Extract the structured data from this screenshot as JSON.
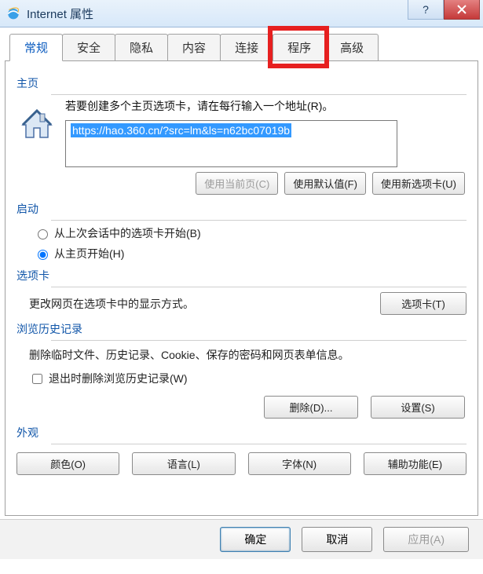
{
  "title": "Internet 属性",
  "tabs": {
    "general": "常规",
    "security": "安全",
    "privacy": "隐私",
    "content": "内容",
    "connections": "连接",
    "programs": "程序",
    "advanced": "高级"
  },
  "homepage": {
    "title": "主页",
    "desc": "若要创建多个主页选项卡，请在每行输入一个地址(R)。",
    "url": "https://hao.360.cn/?src=lm&ls=n62bc07019b",
    "btn_current": "使用当前页(C)",
    "btn_default": "使用默认值(F)",
    "btn_newtab": "使用新选项卡(U)"
  },
  "startup": {
    "title": "启动",
    "opt_last": "从上次会话中的选项卡开始(B)",
    "opt_home": "从主页开始(H)"
  },
  "tabsec": {
    "title": "选项卡",
    "desc": "更改网页在选项卡中的显示方式。",
    "btn": "选项卡(T)"
  },
  "history": {
    "title": "浏览历史记录",
    "desc": "删除临时文件、历史记录、Cookie、保存的密码和网页表单信息。",
    "check": "退出时删除浏览历史记录(W)",
    "btn_delete": "删除(D)...",
    "btn_settings": "设置(S)"
  },
  "appearance": {
    "title": "外观",
    "btn_color": "颜色(O)",
    "btn_lang": "语言(L)",
    "btn_font": "字体(N)",
    "btn_access": "辅助功能(E)"
  },
  "footer": {
    "ok": "确定",
    "cancel": "取消",
    "apply": "应用(A)"
  }
}
